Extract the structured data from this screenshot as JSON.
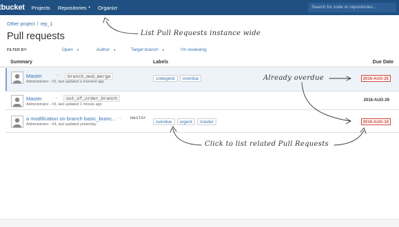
{
  "topbar": {
    "brand": "tbucket",
    "nav": [
      {
        "label": "Projects",
        "has_caret": false
      },
      {
        "label": "Repositories",
        "has_caret": true
      },
      {
        "label": "Organizr",
        "has_caret": false
      }
    ],
    "search_placeholder": "Search for code or repositories..."
  },
  "breadcrumb": {
    "project": "Other project",
    "separator": "/",
    "repo": "rep_1"
  },
  "page": {
    "title": "Pull requests"
  },
  "filters": {
    "label": "FILTER BY:",
    "open": "Open",
    "author": "Author",
    "target_branch": "Target branch",
    "reviewing": "I'm reviewing"
  },
  "table": {
    "headers": {
      "summary": "Summary",
      "labels": "Labels",
      "due": "Due Date"
    },
    "rows": [
      {
        "title": "Master",
        "meta": "Administrator - #2, last updated a moment ago",
        "branch": "branch_mod_merge",
        "labels": [
          "codegeist",
          "overdue"
        ],
        "due": "2016-AUG-25",
        "overdue": true
      },
      {
        "title": "Master",
        "meta": "Administrator - #3, last updated 1 minute ago",
        "branch": "out_of_order_branch",
        "labels": [],
        "due": "2016-AUG-29",
        "overdue": false
      },
      {
        "title": "a modification on branch basic_branc...",
        "meta": "Administrator - #4, last updated yesterday",
        "branch": "master",
        "labels": [
          "overdue",
          "urgent",
          "master"
        ],
        "due": "2016-AUG-10",
        "overdue": true
      }
    ]
  },
  "annotations": {
    "list_instance": "List Pull Requests instance wide",
    "already_overdue": "Already overdue",
    "click_related": "Click to list related Pull Requests"
  },
  "colors": {
    "header_bg": "#205081",
    "link": "#3572b0",
    "overdue": "#d04437"
  },
  "icons": {
    "arrow": "→",
    "caret": "▾"
  }
}
